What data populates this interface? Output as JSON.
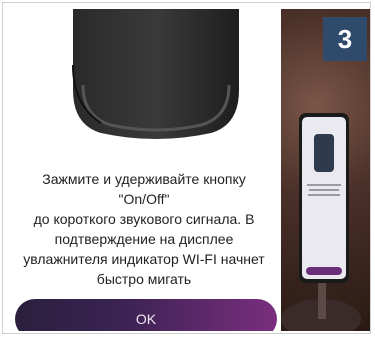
{
  "instruction": {
    "lines": [
      "Зажмите и удерживайте кнопку \"On/Off\"",
      "до короткого звукового сигнала. В",
      "подтверждение на дисплее",
      "увлажнителя индикатор WI-FI начнет",
      "быстро мигать"
    ]
  },
  "ok_button": {
    "label": "OK"
  },
  "step_badge": {
    "number": "3"
  },
  "colors": {
    "badge_bg": "#2f4a6b",
    "button_gradient_start": "#2a1f3e",
    "button_gradient_end": "#7a2e7f"
  }
}
